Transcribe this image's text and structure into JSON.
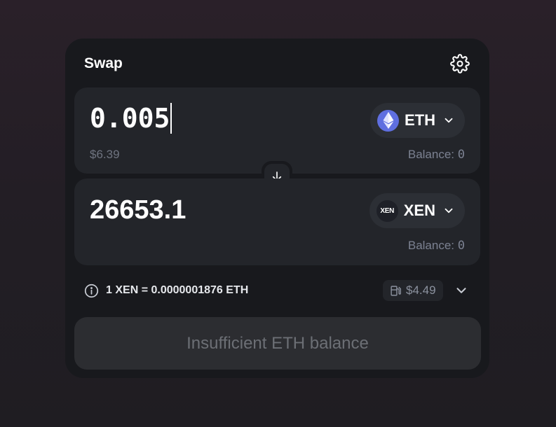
{
  "header": {
    "title": "Swap"
  },
  "from": {
    "amount": "0.005",
    "usd_value": "$6.39",
    "token_symbol": "ETH",
    "balance_label": "Balance: ",
    "balance_value": "0"
  },
  "to": {
    "amount": "26653.1",
    "token_symbol": "XEN",
    "token_logo_text": "XEN",
    "balance_label": "Balance: ",
    "balance_value": "0"
  },
  "rate": {
    "text": "1 XEN = 0.0000001876 ETH",
    "gas_fee": "$4.49"
  },
  "submit": {
    "label": "Insufficient ETH balance"
  },
  "icons": {
    "settings": "gear-icon",
    "swap_direction": "arrow-down-icon",
    "token_dropdown": "chevron-down-icon",
    "info": "info-icon",
    "gas": "gas-pump-icon",
    "expand": "chevron-down-icon"
  },
  "colors": {
    "card_bg": "#18191d",
    "panel_bg": "#23252a",
    "eth_logo": "#5f6fe0",
    "disabled_text": "#6c6f75"
  }
}
